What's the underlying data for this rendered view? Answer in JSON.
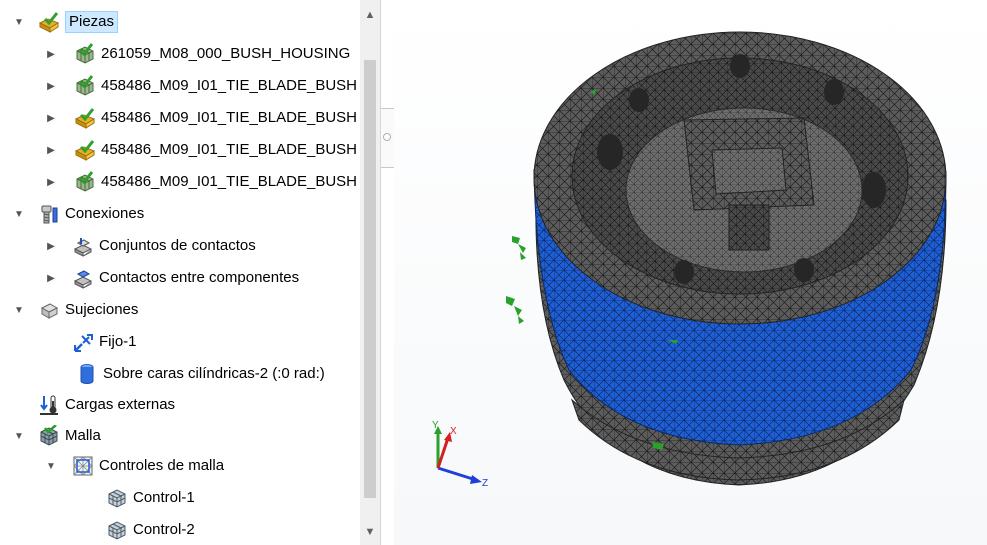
{
  "tree": {
    "items": [
      {
        "label": "Piezas",
        "icon": "parts-folder-icon",
        "selected": true
      },
      {
        "label": "261059_M08_000_BUSH_HOUSING",
        "icon": "meshed-part-icon"
      },
      {
        "label": "458486_M09_I01_TIE_BLADE_BUSH",
        "icon": "meshed-part-icon"
      },
      {
        "label": "458486_M09_I01_TIE_BLADE_BUSH",
        "icon": "part-warning-icon"
      },
      {
        "label": "458486_M09_I01_TIE_BLADE_BUSH",
        "icon": "part-warning-icon"
      },
      {
        "label": "458486_M09_I01_TIE_BLADE_BUSH",
        "icon": "meshed-part-icon"
      },
      {
        "label": "Conexiones",
        "icon": "connections-icon"
      },
      {
        "label": "Conjuntos de contactos",
        "icon": "contact-sets-icon"
      },
      {
        "label": "Contactos entre componentes",
        "icon": "component-contacts-icon"
      },
      {
        "label": "Sujeciones",
        "icon": "fixtures-icon"
      },
      {
        "label": "Fijo-1",
        "icon": "fixed-geometry-icon"
      },
      {
        "label": "Sobre caras cilíndricas-2 (:0 rad:)",
        "icon": "cylinder-icon"
      },
      {
        "label": "Cargas externas",
        "icon": "external-loads-icon"
      },
      {
        "label": "Malla",
        "icon": "mesh-icon"
      },
      {
        "label": "Controles de malla",
        "icon": "mesh-controls-icon"
      },
      {
        "label": "Control-1",
        "icon": "mesh-control-icon"
      },
      {
        "label": "Control-2",
        "icon": "mesh-control-icon"
      }
    ]
  },
  "triad": {
    "x_label": "X",
    "y_label": "Y",
    "z_label": "Z"
  },
  "colors": {
    "selection": "#cde8ff",
    "mesh_face": "#5a5a5a",
    "band": "#1f5fd6",
    "fixture": "#2aa12a"
  }
}
